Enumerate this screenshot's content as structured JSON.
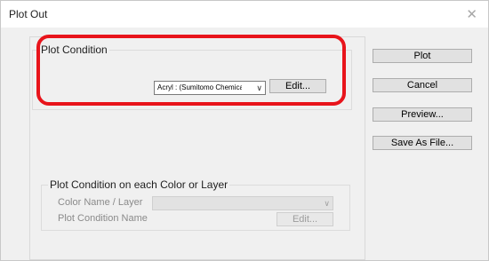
{
  "window": {
    "title": "Plot Out",
    "close_glyph": "✕"
  },
  "plot_condition": {
    "group_label": "Plot Condition",
    "profile_value": "Acryl : (Sumitomo Chemical)SUN",
    "edit_label": "Edit..."
  },
  "buttons": {
    "plot": "Plot",
    "cancel": "Cancel",
    "preview": "Preview...",
    "save_as_file": "Save As File..."
  },
  "per_color": {
    "group_label": "Plot Condition on each Color or Layer",
    "color_name_label": "Color Name / Layer",
    "color_name_value": "",
    "condition_name_label": "Plot Condition Name",
    "edit_label": "Edit..."
  },
  "annotation": {
    "highlight_color": "#e8141b"
  }
}
